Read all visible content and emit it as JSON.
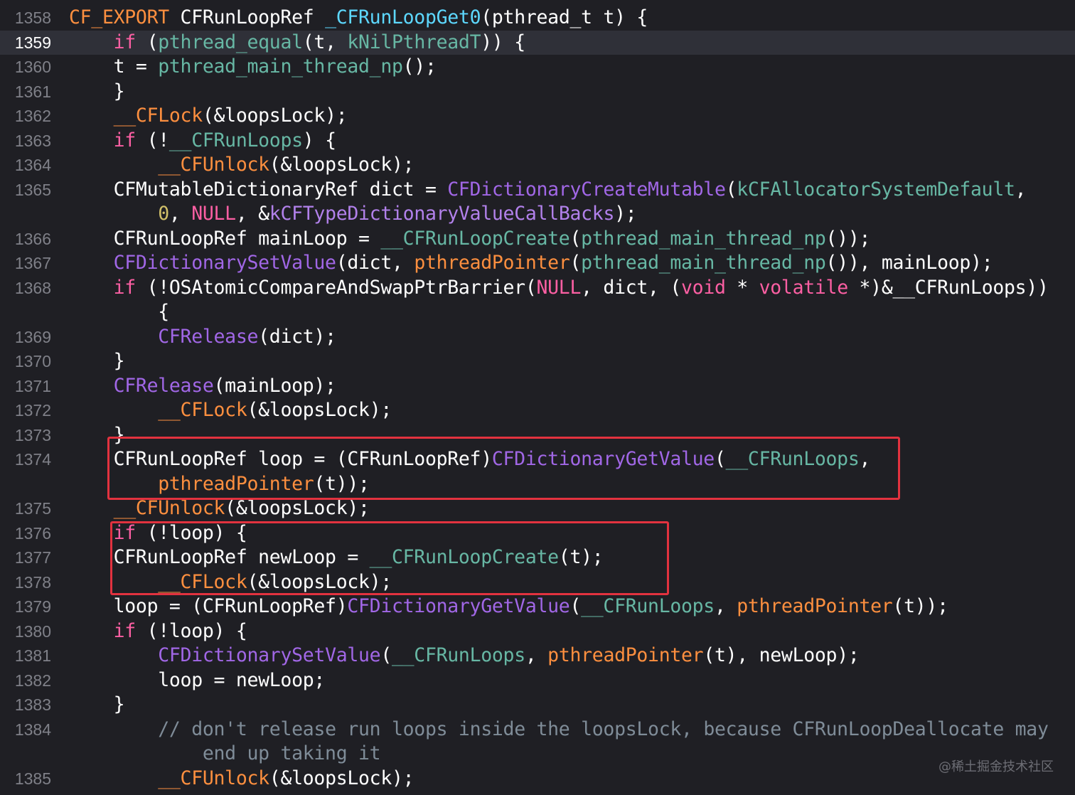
{
  "colors": {
    "background": "#1f1f24",
    "current_line": "#2f3038",
    "keyword": "#fc5fa3",
    "function": "#a167e6",
    "project_symbol": "#67b7a4",
    "macro": "#fd8f3f",
    "comment": "#7f8c98",
    "number": "#d0bf69",
    "highlight_border": "#e2323f"
  },
  "current_line_number": "1359",
  "lines": [
    {
      "num": "1358",
      "tokens": [
        [
          "t-export",
          "CF_EXPORT"
        ],
        [
          "t-plain",
          " CFRunLoopRef "
        ],
        [
          "t-tp",
          "_CFRunLoopGet0"
        ],
        [
          "t-plain",
          "(pthread_t t) {"
        ]
      ]
    },
    {
      "num": "1359",
      "tokens": [
        [
          "t-plain",
          "    "
        ],
        [
          "t-kw",
          "if"
        ],
        [
          "t-plain",
          " ("
        ],
        [
          "t-proj",
          "pthread_equal"
        ],
        [
          "t-plain",
          "(t, "
        ],
        [
          "t-proj",
          "kNilPthreadT"
        ],
        [
          "t-plain",
          ")) {"
        ]
      ]
    },
    {
      "num": "1360",
      "tokens": [
        [
          "t-plain",
          "    t = "
        ],
        [
          "t-proj",
          "pthread_main_thread_np"
        ],
        [
          "t-plain",
          "();"
        ]
      ]
    },
    {
      "num": "1361",
      "tokens": [
        [
          "t-plain",
          "    }"
        ]
      ]
    },
    {
      "num": "1362",
      "tokens": [
        [
          "t-plain",
          "    "
        ],
        [
          "t-macro",
          "__CFLock"
        ],
        [
          "t-plain",
          "(&loopsLock);"
        ]
      ]
    },
    {
      "num": "1363",
      "tokens": [
        [
          "t-plain",
          "    "
        ],
        [
          "t-kw",
          "if"
        ],
        [
          "t-plain",
          " (!"
        ],
        [
          "t-proj",
          "__CFRunLoops"
        ],
        [
          "t-plain",
          ") {"
        ]
      ]
    },
    {
      "num": "1364",
      "tokens": [
        [
          "t-plain",
          "        "
        ],
        [
          "t-macro",
          "__CFUnlock"
        ],
        [
          "t-plain",
          "(&loopsLock);"
        ]
      ]
    },
    {
      "num": "1365",
      "tokens": [
        [
          "t-plain",
          "    CFMutableDictionaryRef dict = "
        ],
        [
          "t-cffunc",
          "CFDictionaryCreateMutable"
        ],
        [
          "t-plain",
          "("
        ],
        [
          "t-proj",
          "kCFAllocatorSystemDefault"
        ],
        [
          "t-plain",
          ","
        ]
      ]
    },
    {
      "num": "",
      "tokens": [
        [
          "t-plain",
          "        "
        ],
        [
          "t-num",
          "0"
        ],
        [
          "t-plain",
          ", "
        ],
        [
          "t-kw",
          "NULL"
        ],
        [
          "t-plain",
          ", &"
        ],
        [
          "t-global",
          "kCFTypeDictionaryValueCallBacks"
        ],
        [
          "t-plain",
          ");"
        ]
      ]
    },
    {
      "num": "1366",
      "tokens": [
        [
          "t-plain",
          "    CFRunLoopRef mainLoop = "
        ],
        [
          "t-proj",
          "__CFRunLoopCreate"
        ],
        [
          "t-plain",
          "("
        ],
        [
          "t-proj",
          "pthread_main_thread_np"
        ],
        [
          "t-plain",
          "());"
        ]
      ]
    },
    {
      "num": "1367",
      "tokens": [
        [
          "t-plain",
          "    "
        ],
        [
          "t-cffunc",
          "CFDictionarySetValue"
        ],
        [
          "t-plain",
          "(dict, "
        ],
        [
          "t-macro",
          "pthreadPointer"
        ],
        [
          "t-plain",
          "("
        ],
        [
          "t-proj",
          "pthread_main_thread_np"
        ],
        [
          "t-plain",
          "()), mainLoop);"
        ]
      ]
    },
    {
      "num": "1368",
      "tokens": [
        [
          "t-plain",
          "    "
        ],
        [
          "t-kw",
          "if"
        ],
        [
          "t-plain",
          " (!OSAtomicCompareAndSwapPtrBarrier("
        ],
        [
          "t-kw",
          "NULL"
        ],
        [
          "t-plain",
          ", dict, ("
        ],
        [
          "t-kw",
          "void"
        ],
        [
          "t-plain",
          " * "
        ],
        [
          "t-kw",
          "volatile"
        ],
        [
          "t-plain",
          " *)&__CFRunLoops))"
        ]
      ]
    },
    {
      "num": "",
      "tokens": [
        [
          "t-plain",
          "        {"
        ]
      ]
    },
    {
      "num": "1369",
      "tokens": [
        [
          "t-plain",
          "        "
        ],
        [
          "t-cffunc",
          "CFRelease"
        ],
        [
          "t-plain",
          "(dict);"
        ]
      ]
    },
    {
      "num": "1370",
      "tokens": [
        [
          "t-plain",
          "    }"
        ]
      ]
    },
    {
      "num": "1371",
      "tokens": [
        [
          "t-plain",
          "    "
        ],
        [
          "t-cffunc",
          "CFRelease"
        ],
        [
          "t-plain",
          "(mainLoop);"
        ]
      ]
    },
    {
      "num": "1372",
      "tokens": [
        [
          "t-plain",
          "        "
        ],
        [
          "t-macro",
          "__CFLock"
        ],
        [
          "t-plain",
          "(&loopsLock);"
        ]
      ]
    },
    {
      "num": "1373",
      "tokens": [
        [
          "t-plain",
          "    }"
        ]
      ]
    },
    {
      "num": "1374",
      "tokens": [
        [
          "t-plain",
          "    CFRunLoopRef loop = (CFRunLoopRef)"
        ],
        [
          "t-cffunc",
          "CFDictionaryGetValue"
        ],
        [
          "t-plain",
          "("
        ],
        [
          "t-proj",
          "__CFRunLoops"
        ],
        [
          "t-plain",
          ","
        ]
      ]
    },
    {
      "num": "",
      "tokens": [
        [
          "t-plain",
          "        "
        ],
        [
          "t-macro",
          "pthreadPointer"
        ],
        [
          "t-plain",
          "(t));"
        ]
      ]
    },
    {
      "num": "1375",
      "tokens": [
        [
          "t-plain",
          "    "
        ],
        [
          "t-macro",
          "__CFUnlock"
        ],
        [
          "t-plain",
          "(&loopsLock);"
        ]
      ]
    },
    {
      "num": "1376",
      "tokens": [
        [
          "t-plain",
          "    "
        ],
        [
          "t-kw",
          "if"
        ],
        [
          "t-plain",
          " (!loop) {"
        ]
      ]
    },
    {
      "num": "1377",
      "tokens": [
        [
          "t-plain",
          "    CFRunLoopRef newLoop = "
        ],
        [
          "t-proj",
          "__CFRunLoopCreate"
        ],
        [
          "t-plain",
          "(t);"
        ]
      ]
    },
    {
      "num": "1378",
      "tokens": [
        [
          "t-plain",
          "        "
        ],
        [
          "t-macro",
          "__CFLock"
        ],
        [
          "t-plain",
          "(&loopsLock);"
        ]
      ]
    },
    {
      "num": "1379",
      "tokens": [
        [
          "t-plain",
          "    loop = (CFRunLoopRef)"
        ],
        [
          "t-cffunc",
          "CFDictionaryGetValue"
        ],
        [
          "t-plain",
          "("
        ],
        [
          "t-proj",
          "__CFRunLoops"
        ],
        [
          "t-plain",
          ", "
        ],
        [
          "t-macro",
          "pthreadPointer"
        ],
        [
          "t-plain",
          "(t));"
        ]
      ]
    },
    {
      "num": "1380",
      "tokens": [
        [
          "t-plain",
          "    "
        ],
        [
          "t-kw",
          "if"
        ],
        [
          "t-plain",
          " (!loop) {"
        ]
      ]
    },
    {
      "num": "1381",
      "tokens": [
        [
          "t-plain",
          "        "
        ],
        [
          "t-cffunc",
          "CFDictionarySetValue"
        ],
        [
          "t-plain",
          "("
        ],
        [
          "t-proj",
          "__CFRunLoops"
        ],
        [
          "t-plain",
          ", "
        ],
        [
          "t-macro",
          "pthreadPointer"
        ],
        [
          "t-plain",
          "(t), newLoop);"
        ]
      ]
    },
    {
      "num": "1382",
      "tokens": [
        [
          "t-plain",
          "        loop = newLoop;"
        ]
      ]
    },
    {
      "num": "1383",
      "tokens": [
        [
          "t-plain",
          "    }"
        ]
      ]
    },
    {
      "num": "1384",
      "tokens": [
        [
          "t-plain",
          "        "
        ],
        [
          "t-comment",
          "// don't release run loops inside the loopsLock, because CFRunLoopDeallocate may"
        ]
      ]
    },
    {
      "num": "",
      "tokens": [
        [
          "t-plain",
          "            "
        ],
        [
          "t-comment",
          "end up taking it"
        ]
      ]
    },
    {
      "num": "1385",
      "tokens": [
        [
          "t-plain",
          "        "
        ],
        [
          "t-macro",
          "__CFUnlock"
        ],
        [
          "t-plain",
          "(&loopsLock);"
        ]
      ]
    }
  ],
  "watermark": "@稀土掘金技术社区"
}
